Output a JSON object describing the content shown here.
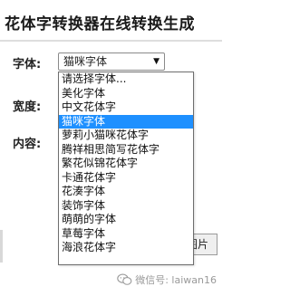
{
  "page": {
    "title": "花体字转换器在线转换生成"
  },
  "form": {
    "font_label": "字体:",
    "width_label": "宽度:",
    "content_label": "内容:",
    "font_select_value": "猫咪字体",
    "font_options": [
      "请选择字体...",
      "美化字体",
      "中文花体字",
      "猫咪字体",
      "萝莉小猫咪花体字",
      "腾祥相思简写花体字",
      "繁花似锦花体字",
      "卡通花体字",
      "花湊字体",
      "装饰字体",
      "萌萌的字体",
      "草莓字体",
      "海浪花体字"
    ],
    "selected_index": 3,
    "save_label": "保存图片"
  },
  "watermark": {
    "text": "微信号: laiwan16",
    "icon": "wechat-icon"
  },
  "colors": {
    "selected_bg": "#1e90ff",
    "divider": "#dedede",
    "watermark": "#9a9a9a"
  }
}
